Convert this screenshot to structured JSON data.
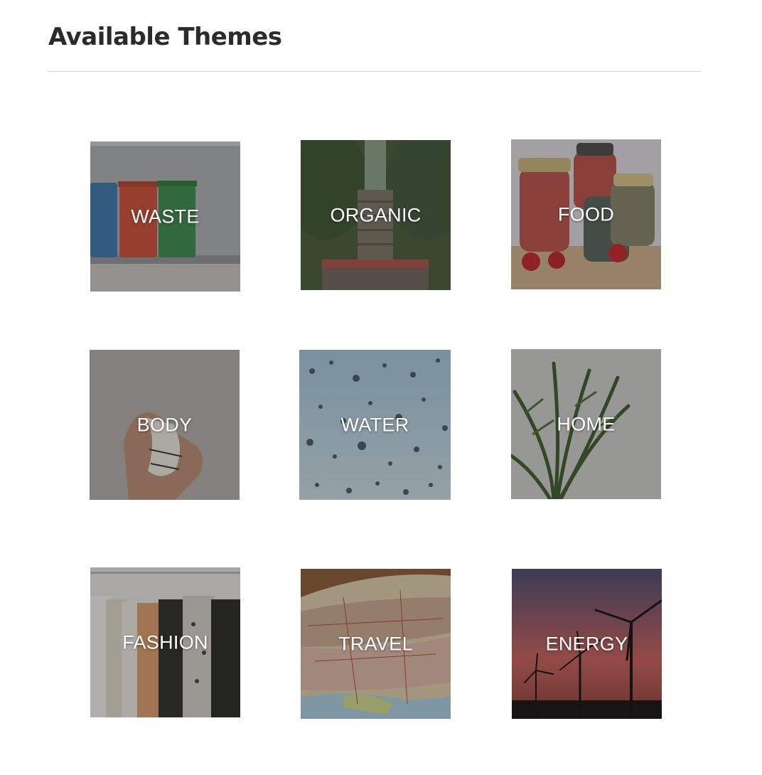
{
  "page": {
    "title": "Available Themes"
  },
  "themes": [
    {
      "label": "WASTE",
      "icon": "waste-bins-image"
    },
    {
      "label": "ORGANIC",
      "icon": "orchard-crates-image"
    },
    {
      "label": "FOOD",
      "icon": "food-jars-image"
    },
    {
      "label": "BODY",
      "icon": "measuring-tape-hand-image"
    },
    {
      "label": "WATER",
      "icon": "raindrops-image"
    },
    {
      "label": "HOME",
      "icon": "house-plant-image"
    },
    {
      "label": "FASHION",
      "icon": "clothing-rack-image"
    },
    {
      "label": "TRAVEL",
      "icon": "map-image"
    },
    {
      "label": "ENERGY",
      "icon": "wind-turbines-image"
    }
  ],
  "colors": {
    "title_text": "#2b2b2b",
    "divider": "#d2d2d2",
    "tile_label": "#ffffff"
  }
}
